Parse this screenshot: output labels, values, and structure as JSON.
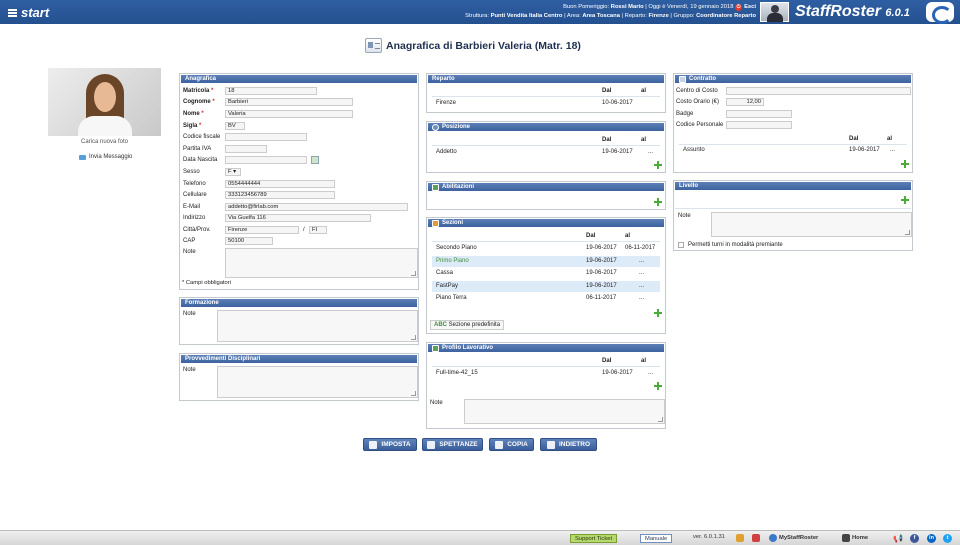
{
  "header": {
    "start_label": "start",
    "greeting": "Buon Pomeriggio: ",
    "user_name": "Rossi Mario",
    "date_text": " | Oggi è Venerdì, 19 gennaio 2018 ",
    "exit_label": "Esci",
    "struttura_label": "Struttura: ",
    "struttura_value": "Punti Vendita Italia Centro",
    "area_label": " | Area: ",
    "area_value": "Area Toscana",
    "reparto_label": " | Reparto: ",
    "reparto_value": "Firenze",
    "gruppo_label": " | Gruppo: ",
    "gruppo_value": "Coordinatore Reparto",
    "brand": "StaffRoster",
    "version": "6.0.1"
  },
  "page_title": "Anagrafica di Barbieri Valeria (Matr. 18)",
  "photo": {
    "upload_caption": "Carica nuova foto",
    "send_message": "Invia Messaggio"
  },
  "anagrafica": {
    "title": "Anagrafica",
    "fields": {
      "matricola": {
        "label": "Matricola",
        "value": "18"
      },
      "cognome": {
        "label": "Cognome",
        "value": "Barbieri"
      },
      "nome": {
        "label": "Nome",
        "value": "Valeria"
      },
      "sigla": {
        "label": "Sigla",
        "value": "BV"
      },
      "codice_fiscale": {
        "label": "Codice fiscale",
        "value": ""
      },
      "partita_iva": {
        "label": "Partita IVA",
        "value": ""
      },
      "data_nascita": {
        "label": "Data Nascita",
        "value": ""
      },
      "sesso": {
        "label": "Sesso",
        "value": "F"
      },
      "telefono": {
        "label": "Telefono",
        "value": "0554444444"
      },
      "cellulare": {
        "label": "Cellulare",
        "value": "333123456789"
      },
      "email": {
        "label": "E-Mail",
        "value": "addetto@firlab.com"
      },
      "indirizzo": {
        "label": "Indirizzo",
        "value": "Via Guelfa 116"
      },
      "citta": {
        "label": "Città/Prov.",
        "value": "Firenze",
        "prov": "FI",
        "sep": "/"
      },
      "cap": {
        "label": "CAP",
        "value": "50100"
      },
      "note": {
        "label": "Note",
        "value": ""
      }
    },
    "required_note": "* Campi obbligatori",
    "required_mark": "*"
  },
  "formazione": {
    "title": "Formazione",
    "note_label": "Note"
  },
  "provvedimenti": {
    "title": "Provvedimenti Disciplinari",
    "note_label": "Note"
  },
  "reparto": {
    "title": "Reparto",
    "col_dal": "Dal",
    "col_al": "al",
    "rows": [
      {
        "name": "Firenze",
        "dal": "10-06-2017",
        "al": ""
      }
    ]
  },
  "posizione": {
    "title": "Posizione",
    "col_dal": "Dal",
    "col_al": "al",
    "rows": [
      {
        "name": "Addetto",
        "dal": "19-06-2017",
        "al": "..."
      }
    ]
  },
  "abilitazioni": {
    "title": "Abilitazioni"
  },
  "sezioni": {
    "title": "Sezioni",
    "col_dal": "Dal",
    "col_al": "al",
    "rows": [
      {
        "name": "Secondo Piano",
        "dal": "19-06-2017",
        "al": "06-11-2017"
      },
      {
        "name": "Primo Piano",
        "dal": "19-06-2017",
        "al": "..."
      },
      {
        "name": "Cassa",
        "dal": "19-06-2017",
        "al": "..."
      },
      {
        "name": "FastPay",
        "dal": "19-06-2017",
        "al": "..."
      },
      {
        "name": "Piano Terra",
        "dal": "06-11-2017",
        "al": "..."
      }
    ],
    "default_prefix": "ABC",
    "default_label": "Sezione predefinita"
  },
  "profilo": {
    "title": "Profilo Lavorativo",
    "col_dal": "Dal",
    "col_al": "al",
    "rows": [
      {
        "name": "Full-time-42_15",
        "dal": "19-06-2017",
        "al": "..."
      }
    ],
    "note_label": "Note"
  },
  "contratto": {
    "title": "Contratto",
    "centro_costo": {
      "label": "Centro di Costo",
      "value": ""
    },
    "costo_orario": {
      "label": "Costo Orario (€)",
      "value": "12,00"
    },
    "badge": {
      "label": "Badge",
      "value": ""
    },
    "codice_personale": {
      "label": "Codice Personale",
      "value": ""
    },
    "col_dal": "Dal",
    "col_al": "al",
    "rows": [
      {
        "name": "Assunto",
        "dal": "19-06-2017",
        "al": "..."
      }
    ]
  },
  "livello": {
    "title": "Livello",
    "note_label": "Note",
    "premium_label": "Permetti turni in modalità premiante"
  },
  "buttons": {
    "imposta": "IMPOSTA",
    "spettanze": "SPETTANZE",
    "copia": "COPIA",
    "indietro": "INDIETRO"
  },
  "footer": {
    "support": "Support Ticket",
    "manuale": "Manuale",
    "version": "ver. 6.0.1.31",
    "mystaffroster": "MyStaffRoster",
    "home": "Home"
  },
  "colors": {
    "header_blue": "#2a5a9e",
    "panel_header": "#4a6fab",
    "add_green": "#4caa3a",
    "highlight_row": "#ddeaf8",
    "link_green": "#3f8f3a"
  }
}
